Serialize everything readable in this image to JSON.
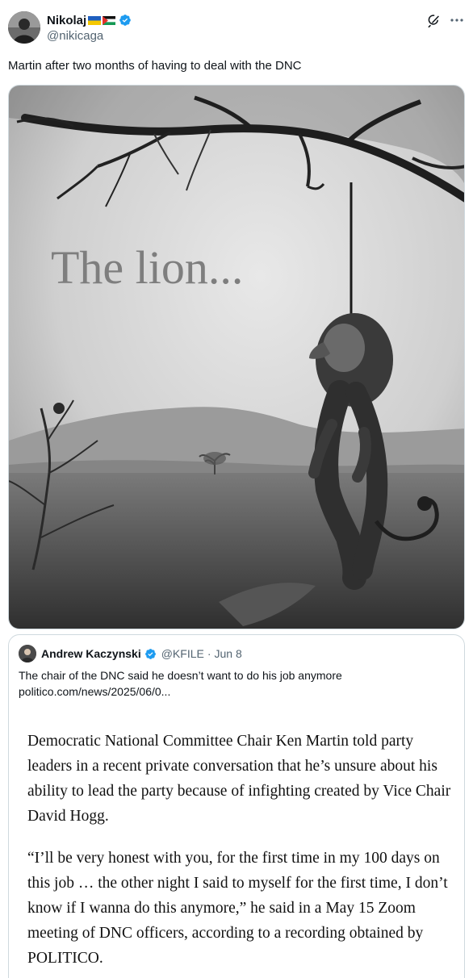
{
  "author": {
    "name": "Nikolaj",
    "handle": "@nikicaga",
    "flags": [
      "ukraine-flag",
      "palestine-flag"
    ],
    "verified": true
  },
  "tweet": {
    "text": "Martin after two months of having to deal with the DNC"
  },
  "media": {
    "overlay_text": "The lion..."
  },
  "quote": {
    "name": "Andrew Kaczynski",
    "handle": "@KFILE",
    "date": "Jun 8",
    "text_line1": "The chair of the DNC said he doesn’t want to do his job anymore",
    "text_line2": "politico.com/news/2025/06/0...",
    "article_p1": "Democratic National Committee Chair Ken Martin told party leaders in a recent private conversation that he’s unsure about his ability to lead the party because of infighting created by Vice Chair David Hogg.",
    "article_p2": "“I’ll be very honest with you, for the first time in my 100 days on this job … the other night I said to myself for the first time, I don’t know if I wanna do this anymore,” he said in a May 15 Zoom meeting of DNC officers, according to a recording obtained by POLITICO."
  },
  "icons": {
    "grok": "grok-icon",
    "more": "more-icon",
    "verified": "verified-badge-icon"
  },
  "colors": {
    "text": "#0f1419",
    "secondary": "#536471",
    "verified": "#1d9bf0",
    "border": "#cfd9de"
  }
}
